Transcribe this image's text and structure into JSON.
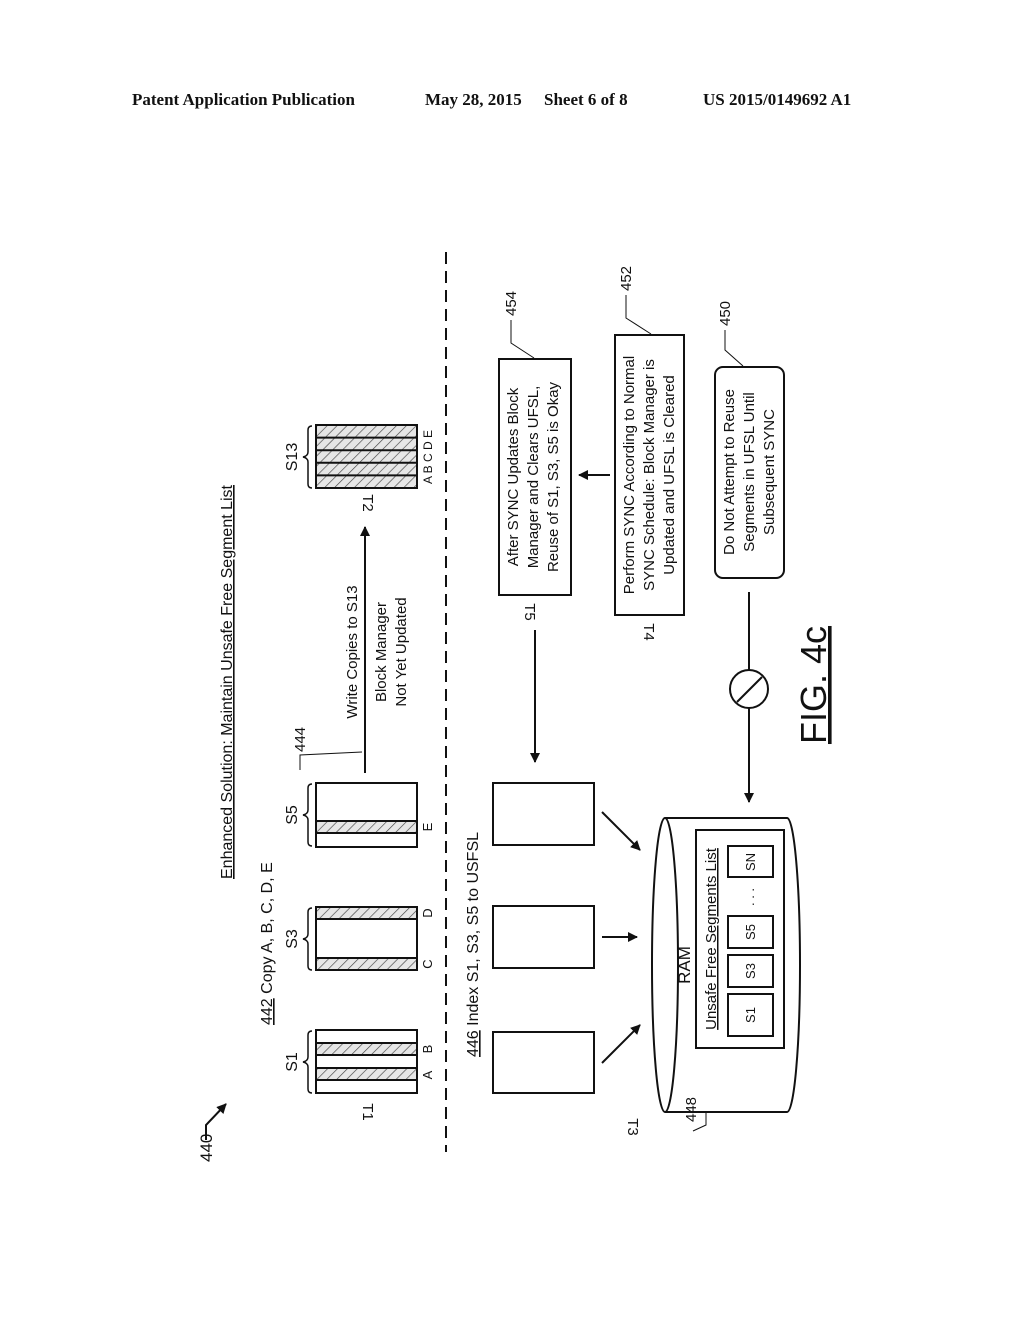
{
  "header": {
    "publication": "Patent Application Publication",
    "date": "May 28, 2015",
    "sheet": "Sheet 6 of 8",
    "number": "US 2015/0149692 A1"
  },
  "figure": {
    "ref": "440",
    "title": "Enhanced Solution: Maintain Unsafe Free Segment List",
    "caption": "FIG. 4c",
    "step_442": {
      "ref": "442",
      "text": " Copy A, B, C, D, E"
    },
    "segments": [
      {
        "name": "S1",
        "blocks": [
          "A",
          "B"
        ]
      },
      {
        "name": "S3",
        "blocks": [
          "C",
          "D"
        ]
      },
      {
        "name": "S5",
        "blocks": [
          "E"
        ]
      }
    ],
    "target_segment": {
      "name": "S13",
      "blocks": "A B C D E"
    },
    "times": {
      "t1": "T1",
      "t2": "T2",
      "t3": "T3",
      "t4": "T4",
      "t5": "T5"
    },
    "write_arrow": {
      "ref": "444",
      "line1": "Write Copies to S13",
      "line2": "Block Manager",
      "line3": "Not Yet Updated"
    },
    "step_446": {
      "ref": "446",
      "text": " Index S1, S3, S5 to USFSL"
    },
    "ram": {
      "ref": "448",
      "label": "RAM",
      "list_title": "Unsafe Free Segments List",
      "items": [
        "S1",
        "S3",
        "S5",
        "SN"
      ],
      "ellipsis": ". . ."
    },
    "box_450": {
      "ref": "450",
      "lines": [
        "Do Not Attempt to Reuse",
        "Segments in UFSL Until",
        "Subsequent SYNC"
      ]
    },
    "box_452": {
      "ref": "452",
      "lines": [
        "Perform SYNC According to Normal",
        "SYNC Schedule: Block Manager is",
        "Updated and UFSL is Cleared"
      ]
    },
    "box_454": {
      "ref": "454",
      "lines": [
        "After SYNC Updates Block",
        "Manager and Clears UFSL,",
        "Reuse of S1, S3, S5 is Okay"
      ]
    }
  }
}
